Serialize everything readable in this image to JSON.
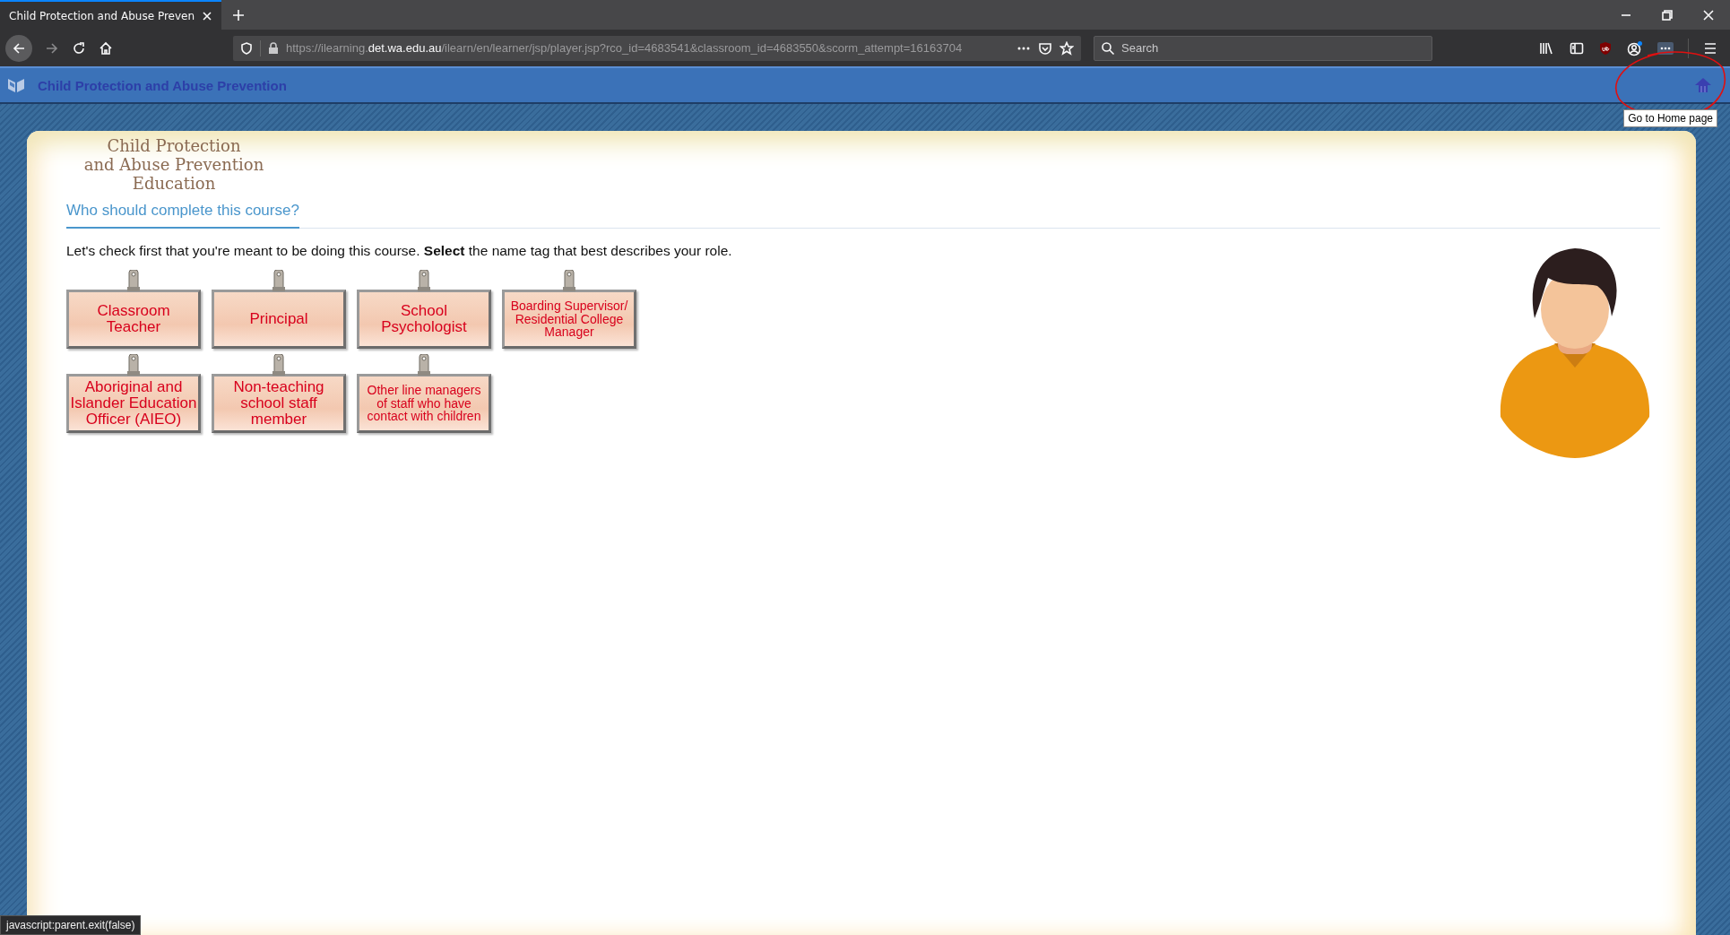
{
  "browser": {
    "tabs": [
      {
        "title": "Child Protection and Abuse Preven",
        "selected": true
      }
    ],
    "url": {
      "prefix": "https://ilearning.",
      "domain": "det.wa.edu.au",
      "path": "/ilearn/en/learner/jsp/player.jsp?rco_id=4683541&classroom_id=4683550&scorm_attempt=16163704"
    },
    "search": {
      "placeholder": "Search"
    },
    "status_text": "javascript:parent.exit(false)"
  },
  "app_header": {
    "title": "Child Protection and Abuse Prevention",
    "home_tooltip": "Go to Home page"
  },
  "course": {
    "logo_lines": [
      "Child Protection",
      "and Abuse Prevention",
      "Education"
    ],
    "heading": "Who should complete this course?",
    "instruction": "Let's check first that you're meant to be doing this course. **Select** the name tag that best describes your role.",
    "name_tags": [
      {
        "label": "Classroom\nTeacher"
      },
      {
        "label": "Principal"
      },
      {
        "label": "School\nPsychologist"
      },
      {
        "label": "Boarding Supervisor/\nResidential College\nManager"
      },
      {
        "label": "Aboriginal and\nIslander Education\nOfficer (AIEO)"
      },
      {
        "label": "Non-teaching\nschool staff\nmember"
      },
      {
        "label": "Other line managers\nof staff who have\ncontact with children"
      }
    ]
  }
}
